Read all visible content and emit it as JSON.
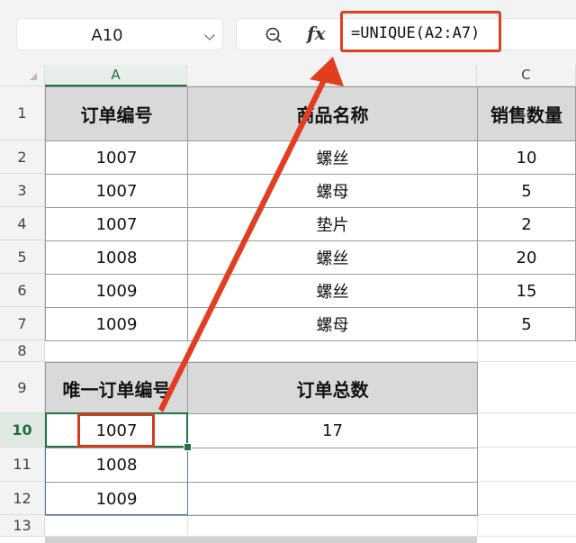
{
  "formula_bar": {
    "name_box": "A10",
    "zoom_icon": "zoom-out-icon",
    "fx_label": "fx",
    "formula": "=UNIQUE(A2:A7)"
  },
  "columns": [
    "A",
    "B",
    "C"
  ],
  "rows": [
    "1",
    "2",
    "3",
    "4",
    "5",
    "6",
    "7",
    "8",
    "9",
    "10",
    "11",
    "12",
    "13"
  ],
  "table": {
    "headers": [
      "订单编号",
      "商品名称",
      "销售数量"
    ],
    "rows": [
      [
        "1007",
        "螺丝",
        "10"
      ],
      [
        "1007",
        "螺母",
        "5"
      ],
      [
        "1007",
        "垫片",
        "2"
      ],
      [
        "1008",
        "螺丝",
        "20"
      ],
      [
        "1009",
        "螺丝",
        "15"
      ],
      [
        "1009",
        "螺母",
        "5"
      ]
    ]
  },
  "result": {
    "header_unique": "唯一订单编号",
    "header_total": "订单总数",
    "unique_ids": [
      "1007",
      "1008",
      "1009"
    ],
    "total": "17"
  },
  "colors": {
    "highlight": "#e23d20",
    "selection": "#217346",
    "header_fill": "#d9d9d9"
  }
}
